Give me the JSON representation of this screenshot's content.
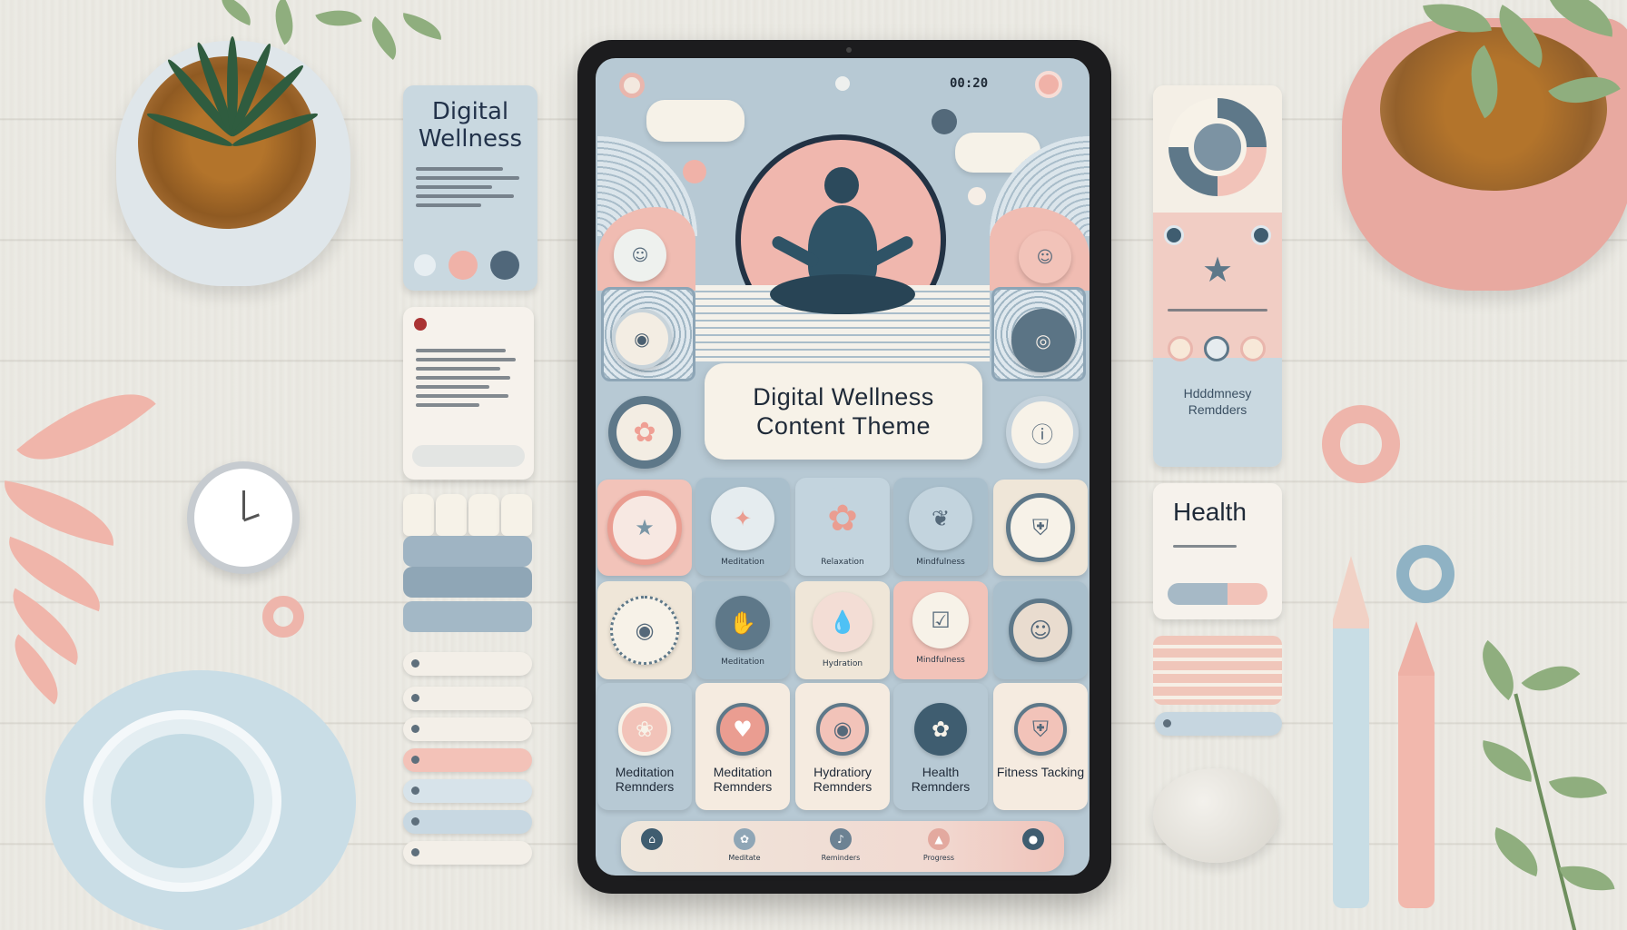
{
  "colors": {
    "desk": "#ecebe5",
    "pastel_blue": "#b7c9d4",
    "pastel_pink": "#f0b7ae",
    "cream": "#f7f2e8",
    "slate": "#2f5366"
  },
  "device": {
    "status_time": "00:20"
  },
  "hero": {
    "line1": "Digital Wellness",
    "line2": "Content Theme"
  },
  "left_card": {
    "title_line1": "Digital",
    "title_line2": "Wellness"
  },
  "right_cards": {
    "reminders_title": "Hdddmnesy Remdders",
    "health_title": "Health"
  },
  "tiles_row3": [
    {
      "label": "Meditation Remnders",
      "icon": "petal-icon"
    },
    {
      "label": "Meditation Remnders",
      "icon": "hand-heart-icon"
    },
    {
      "label": "Hydratiory Remnders",
      "icon": "drop-icon"
    },
    {
      "label": "Health Remnders",
      "icon": "flower-icon"
    },
    {
      "label": "Fitness Tacking",
      "icon": "shield-icon"
    }
  ],
  "tiles_row2": [
    {
      "label": "",
      "icon": "sun-dots-icon"
    },
    {
      "label": "Meditation",
      "icon": "hand-icon"
    },
    {
      "label": "Hydration",
      "icon": "drop-icon"
    },
    {
      "label": "Mindfulness",
      "icon": "checklist-icon"
    },
    {
      "label": "",
      "icon": "face-icon"
    }
  ],
  "tiles_row1": [
    {
      "label": "",
      "icon": "star-icon"
    },
    {
      "label": "Meditation",
      "icon": "star-icon"
    },
    {
      "label": "Relaxation",
      "icon": "star-icon"
    },
    {
      "label": "Mindfulness",
      "icon": "leaf-icon"
    },
    {
      "label": "",
      "icon": "shield-icon"
    }
  ],
  "nav": [
    {
      "label": "",
      "icon": "home-icon"
    },
    {
      "label": "Meditate",
      "icon": "lotus-icon"
    },
    {
      "label": "Reminders",
      "icon": "bell-icon"
    },
    {
      "label": "Progress",
      "icon": "chart-icon"
    },
    {
      "label": "",
      "icon": "profile-icon"
    }
  ]
}
